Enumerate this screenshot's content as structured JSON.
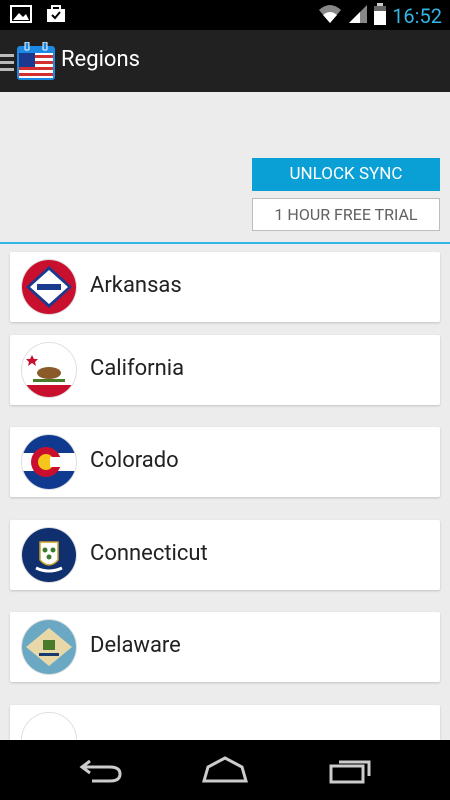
{
  "status_bar": {
    "time": "16:52",
    "icons": [
      "gallery-icon",
      "briefcase-icon",
      "wifi-icon",
      "signal-icon",
      "battery-icon"
    ]
  },
  "action_bar": {
    "title": "Regions",
    "icons": [
      "menu-icon",
      "calendar-flag-icon"
    ]
  },
  "sync": {
    "unlock_label": "UNLOCK SYNC",
    "trial_label": "1 HOUR FREE TRIAL"
  },
  "regions": [
    {
      "name": "Arkansas",
      "flag_icon": "arkansas-flag-icon"
    },
    {
      "name": "California",
      "flag_icon": "california-flag-icon"
    },
    {
      "name": "Colorado",
      "flag_icon": "colorado-flag-icon"
    },
    {
      "name": "Connecticut",
      "flag_icon": "connecticut-flag-icon"
    },
    {
      "name": "Delaware",
      "flag_icon": "delaware-flag-icon"
    },
    {
      "name": "",
      "flag_icon": "partial-flag-icon"
    }
  ],
  "nav_bar": {
    "icons": [
      "back-icon",
      "home-icon",
      "recent-apps-icon"
    ]
  },
  "colors": {
    "accent": "#33b5e5",
    "unlock_button": "#0aa0d6",
    "action_bar": "#212121"
  }
}
